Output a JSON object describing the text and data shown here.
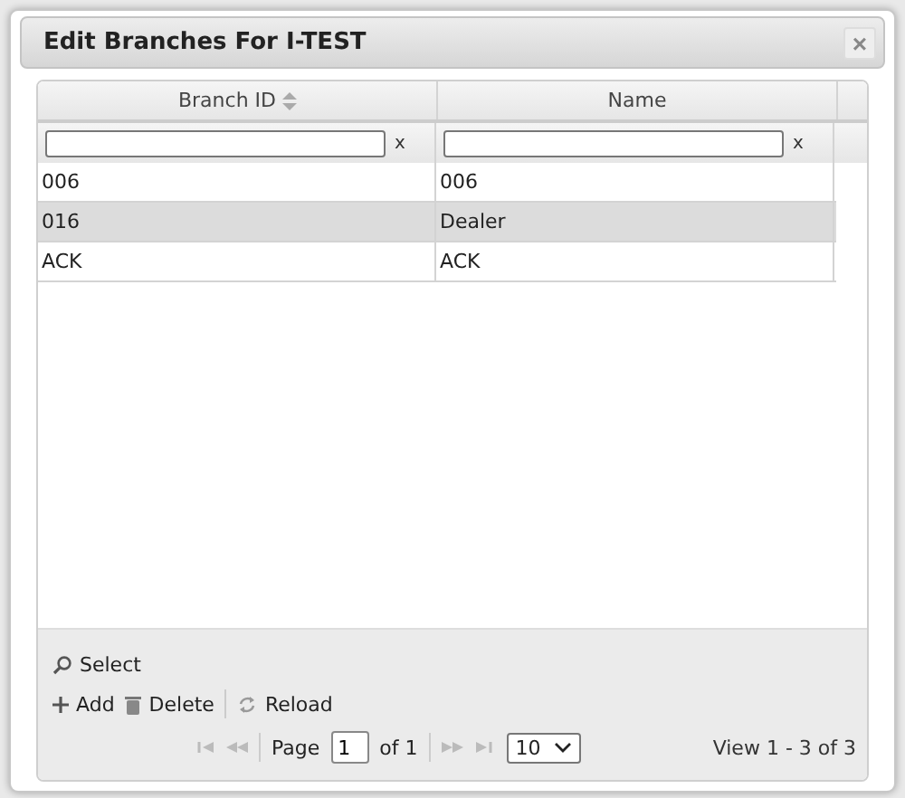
{
  "dialog": {
    "title": "Edit Branches For I-TEST",
    "close": "×"
  },
  "table": {
    "columns": [
      {
        "label": "Branch ID",
        "sortable": true
      },
      {
        "label": "Name",
        "sortable": false
      }
    ],
    "filters": [
      {
        "clear": "x"
      },
      {
        "clear": "x"
      }
    ],
    "rows": [
      {
        "cells": [
          "006",
          "006"
        ],
        "selected": false
      },
      {
        "cells": [
          "016",
          "Dealer"
        ],
        "selected": true
      },
      {
        "cells": [
          "ACK",
          "ACK"
        ],
        "selected": false
      }
    ]
  },
  "toolbar": [
    {
      "kind": "select",
      "label": "Select"
    }
  ],
  "actions": [
    {
      "kind": "add",
      "label": "Add"
    },
    {
      "kind": "delete",
      "label": "Delete"
    },
    {
      "kind": "reload",
      "label": "Reload"
    }
  ],
  "pager": {
    "page_label": "Page",
    "page": "1",
    "of": "of 1",
    "page_size": "10",
    "summary": "View 1 - 3 of 3"
  }
}
